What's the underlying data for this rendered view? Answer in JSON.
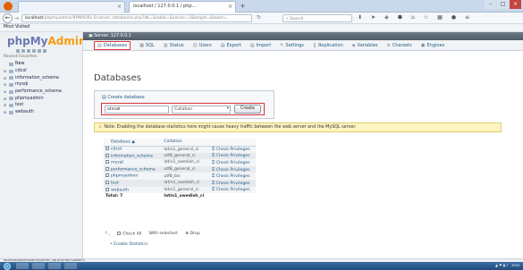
{
  "browser": {
    "tabs": [
      {
        "label": "",
        "close": "×"
      },
      {
        "label": "localhost / 127.0.0.1 / php...",
        "close": "×"
      }
    ],
    "newtab": "+",
    "url_host": "localhost",
    "url_rest": "/phpmyadmin/#PMAURL-0:server_databases.php?db=&table=&server=1&target=&token=",
    "search_placeholder": "Search",
    "bookmarks": "Most Visited",
    "window_buttons": [
      "–",
      "□",
      "×"
    ]
  },
  "pma": {
    "logo_php": "php",
    "logo_my": "My",
    "logo_admin": "Admin",
    "recent_favorites": "Recent  Favorites",
    "tree": [
      "New",
      "cdcol",
      "information_schema",
      "mysql",
      "performance_schema",
      "phpmyadmin",
      "test",
      "webauth"
    ],
    "server_label": "Server: 127.0.0.1",
    "menu": [
      {
        "label": "Databases",
        "glyph": "▤",
        "active": true
      },
      {
        "label": "SQL",
        "glyph": "▦",
        "active": false
      },
      {
        "label": "Status",
        "glyph": "▥",
        "active": false
      },
      {
        "label": "Users",
        "glyph": "☺",
        "active": false
      },
      {
        "label": "Export",
        "glyph": "▤",
        "active": false
      },
      {
        "label": "Import",
        "glyph": "▤",
        "active": false
      },
      {
        "label": "Settings",
        "glyph": "✎",
        "active": false
      },
      {
        "label": "Replication",
        "glyph": "❙",
        "active": false
      },
      {
        "label": "Variables",
        "glyph": "◈",
        "active": false
      },
      {
        "label": "Charsets",
        "glyph": "≡",
        "active": false
      },
      {
        "label": "Engines",
        "glyph": "▣",
        "active": false
      }
    ],
    "page_title": "Databases",
    "create_label": "Create database",
    "db_name_value": "otmall",
    "collation_placeholder": "Collation",
    "create_button": "Create",
    "notice": "Note: Enabling the database statistics here might cause heavy traffic between the web server and the MySQL server.",
    "table_headers": [
      "Database",
      "Collation",
      ""
    ],
    "rows": [
      {
        "name": "cdcol",
        "collation": "latin1_general_ci",
        "priv": "Check Privileges"
      },
      {
        "name": "information_schema",
        "collation": "utf8_general_ci",
        "priv": "Check Privileges"
      },
      {
        "name": "mysql",
        "collation": "latin1_swedish_ci",
        "priv": "Check Privileges"
      },
      {
        "name": "performance_schema",
        "collation": "utf8_general_ci",
        "priv": "Check Privileges"
      },
      {
        "name": "phpmyadmin",
        "collation": "utf8_bin",
        "priv": "Check Privileges"
      },
      {
        "name": "test",
        "collation": "latin1_swedish_ci",
        "priv": "Check Privileges"
      },
      {
        "name": "webauth",
        "collation": "latin1_general_ci",
        "priv": "Check Privileges"
      }
    ],
    "total_label": "Total: 7",
    "total_collation": "latin1_swedish_ci",
    "check_all": "Check All",
    "with_selected": "With selected:",
    "drop": "Drop",
    "enable_stats": "Enable Statistics"
  },
  "statusbar": "localhost/phpmyadmin/server_sql.php?db=&token=",
  "tray_time": "9:00"
}
